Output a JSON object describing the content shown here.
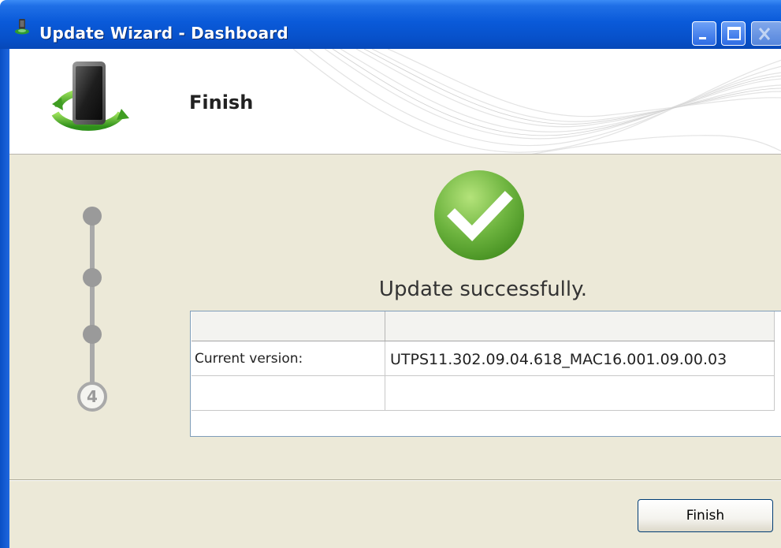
{
  "window": {
    "title": "Update Wizard - Dashboard",
    "app_icon": "phone-stand-icon",
    "controls": [
      "minimize-icon",
      "maximize-icon",
      "close-icon"
    ]
  },
  "header": {
    "step_title": "Finish",
    "logo_icon": "phone-update-arrows-icon"
  },
  "steps": {
    "total": 4,
    "current": "4",
    "completed_icon": "step-dot-icon"
  },
  "result": {
    "icon": "success-check-icon",
    "message": "Update successfully."
  },
  "info_table": {
    "columns": [
      "",
      ""
    ],
    "rows": [
      [
        "Current version:",
        "UTPS11.302.09.04.618_MAC16.001.09.00.03"
      ],
      [
        "",
        ""
      ]
    ]
  },
  "footer": {
    "finish_label": "Finish"
  },
  "colors": {
    "titlebar": "#0a5ad9",
    "body_bg": "#ece9d8",
    "success_green": "#6cb33e",
    "step_gray": "#9a9a9a"
  }
}
